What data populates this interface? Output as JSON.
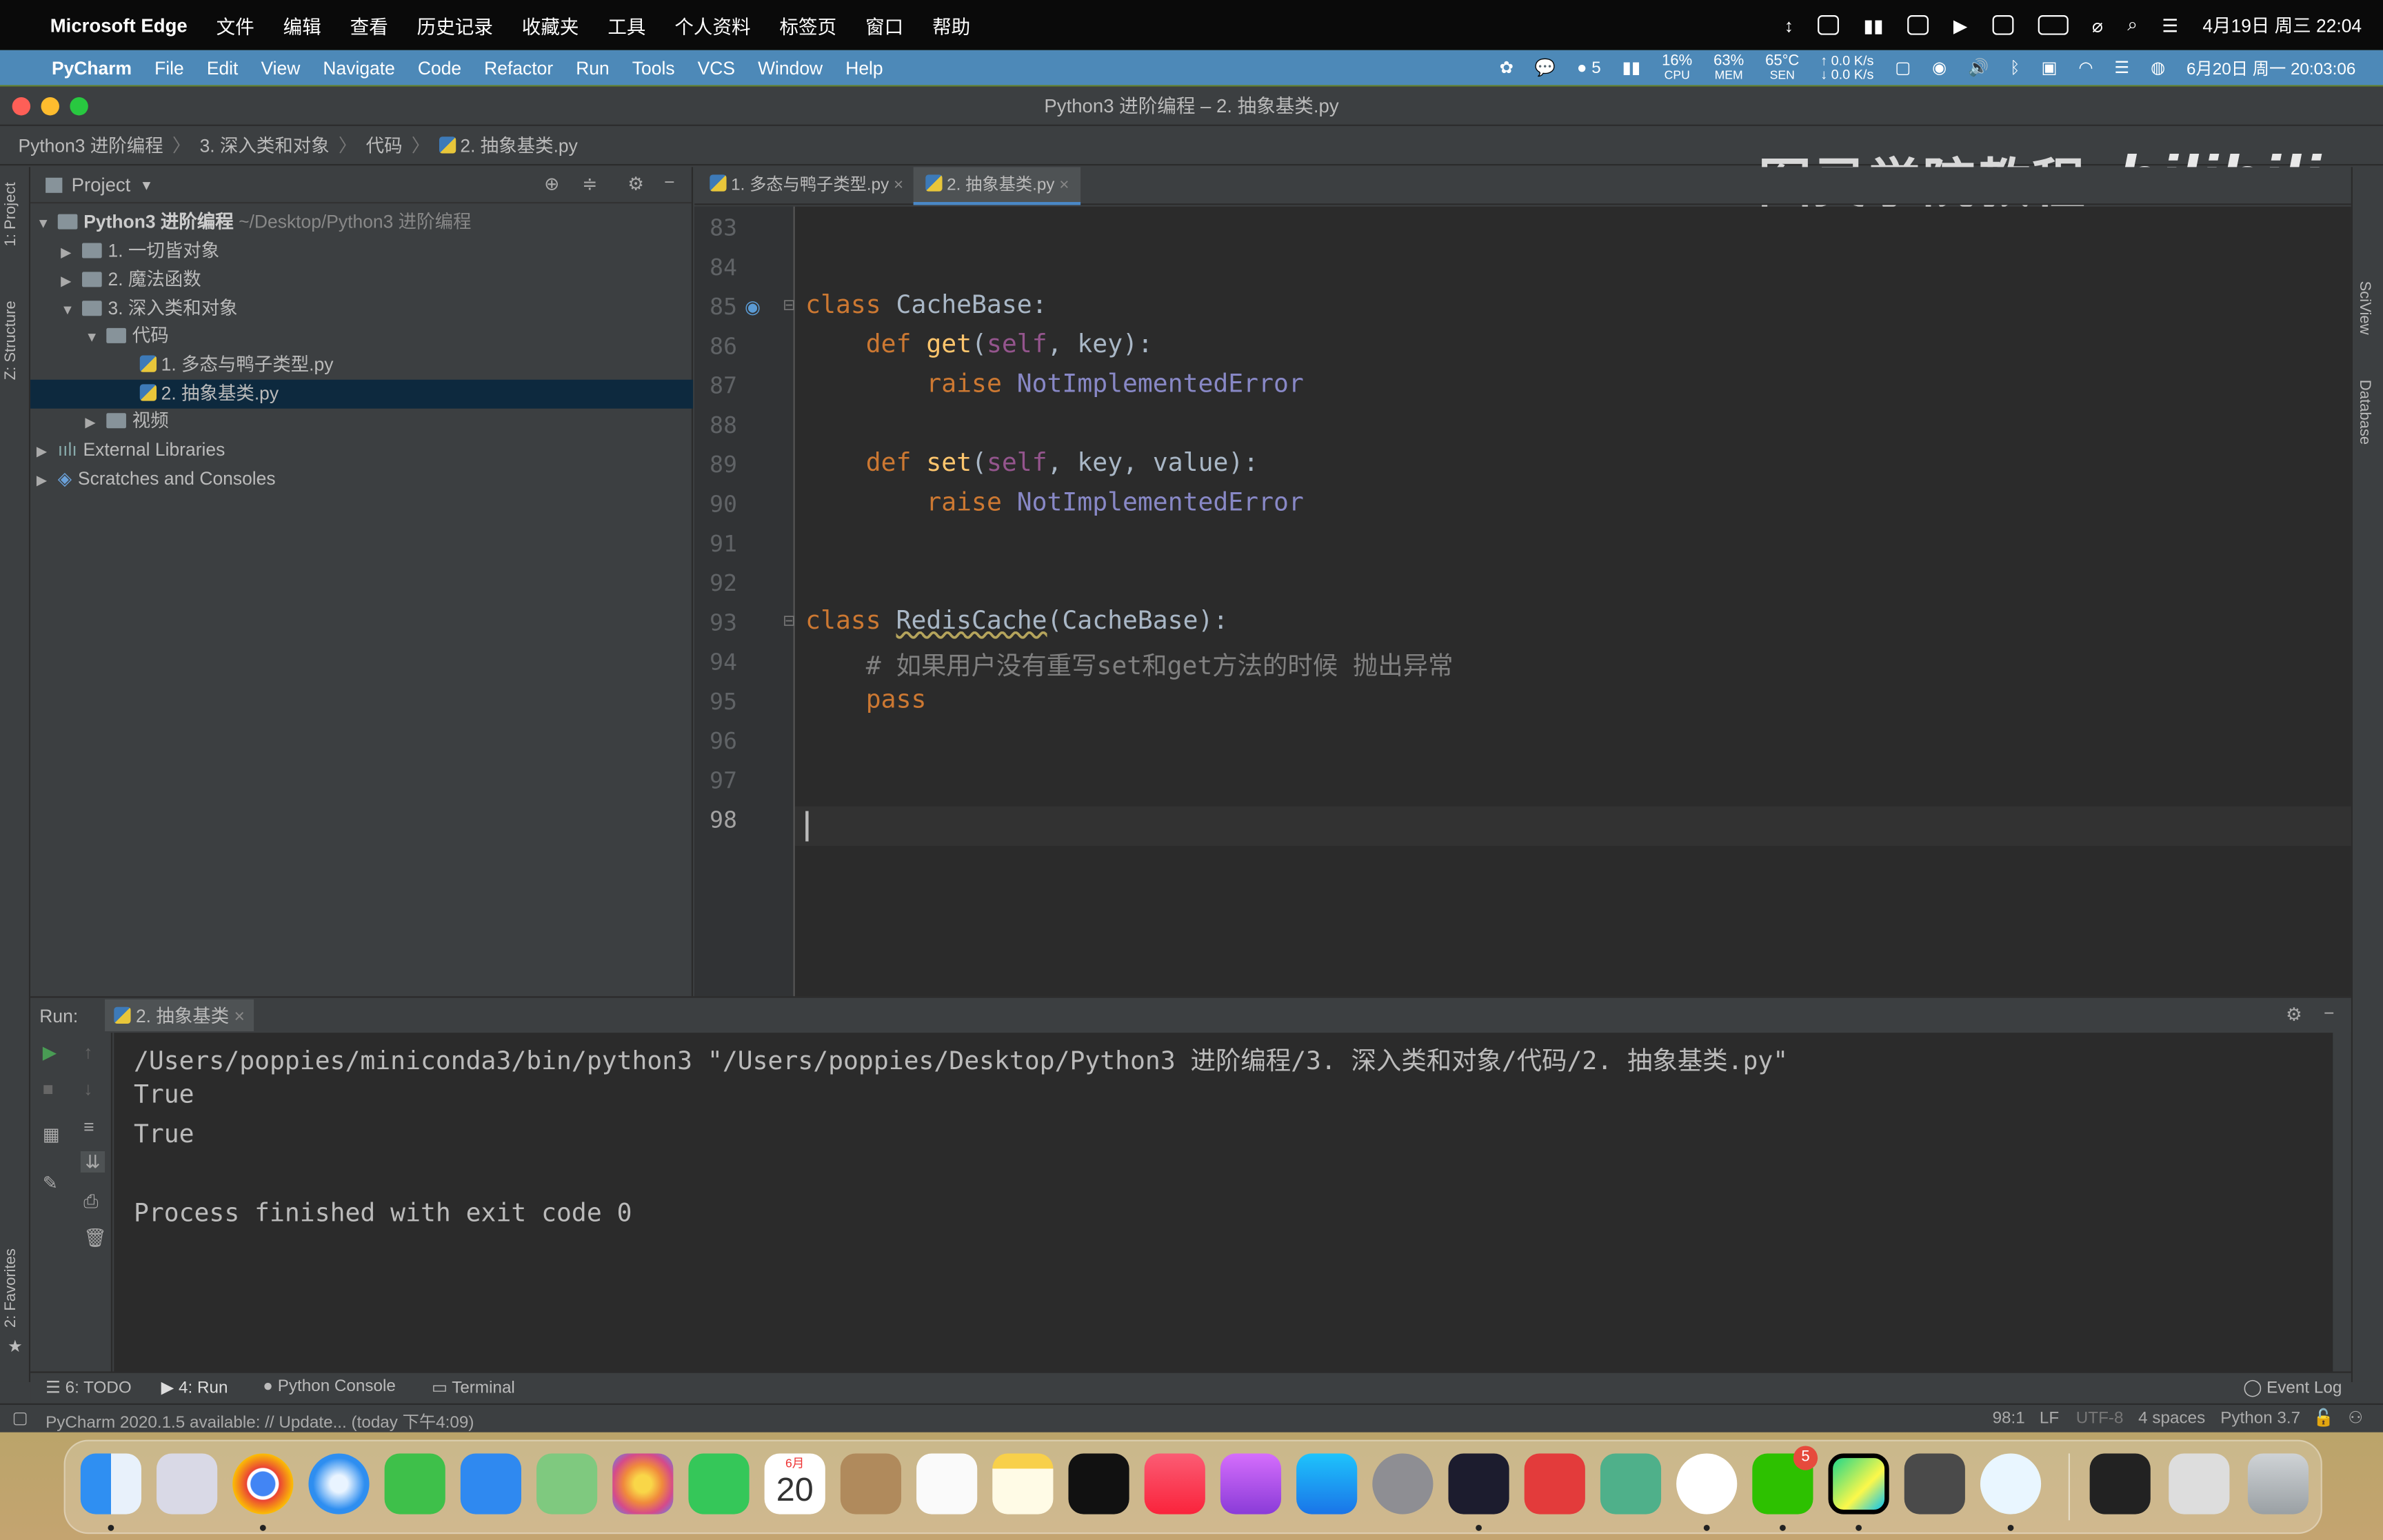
{
  "mac_menu": {
    "app": "Microsoft Edge",
    "items": [
      "文件",
      "编辑",
      "查看",
      "历史记录",
      "收藏夹",
      "工具",
      "个人资料",
      "标签页",
      "窗口",
      "帮助"
    ],
    "datetime": "4月19日 周三 22:04"
  },
  "pc_menu": {
    "app": "PyCharm",
    "items": [
      "File",
      "Edit",
      "View",
      "Navigate",
      "Code",
      "Refactor",
      "Run",
      "Tools",
      "VCS",
      "Window",
      "Help"
    ],
    "wechat_count": "5",
    "cpu": "16%",
    "cpu_label": "CPU",
    "mem": "63%",
    "mem_label": "MEM",
    "temp": "65°C",
    "temp_label": "SEN",
    "net_up": "↑ 0.0 K/s",
    "net_down": "↓ 0.0 K/s",
    "datetime": "6月20日 周一 20:03:06"
  },
  "window": {
    "title": "Python3 进阶编程 – 2. 抽象基类.py"
  },
  "breadcrumb": [
    "Python3 进阶编程",
    "3. 深入类和对象",
    "代码",
    "2. 抽象基类.py"
  ],
  "watermark": {
    "text": "图灵学院教程",
    "logo": "bilibili"
  },
  "left_strip": {
    "project_tab": "1: Project",
    "structure_tab": "Z: Structure",
    "favorites_tab": "2: Favorites"
  },
  "right_strip": {
    "sciview": "SciView",
    "database": "Database"
  },
  "project": {
    "title": "Project",
    "root": {
      "name": "Python3 进阶编程",
      "path": "~/Desktop/Python3 进阶编程"
    },
    "items": [
      {
        "label": "1. 一切皆对象"
      },
      {
        "label": "2. 魔法函数"
      },
      {
        "label": "3. 深入类和对象"
      },
      {
        "label": "代码"
      },
      {
        "label": "1. 多态与鸭子类型.py"
      },
      {
        "label": "2. 抽象基类.py"
      },
      {
        "label": "视频"
      },
      {
        "label": "External Libraries"
      },
      {
        "label": "Scratches and Consoles"
      }
    ]
  },
  "tabs": [
    {
      "label": "1. 多态与鸭子类型.py"
    },
    {
      "label": "2. 抽象基类.py"
    }
  ],
  "editor": {
    "line_numbers": [
      "83",
      "84",
      "85",
      "86",
      "87",
      "88",
      "89",
      "90",
      "91",
      "92",
      "93",
      "94",
      "95",
      "96",
      "97",
      "98"
    ],
    "comment": "# 如果用户没有重写set和get方法的时候 抛出异常"
  },
  "run": {
    "label": "Run:",
    "config": "2. 抽象基类",
    "lines": [
      "/Users/poppies/miniconda3/bin/python3 \"/Users/poppies/Desktop/Python3 进阶编程/3. 深入类和对象/代码/2. 抽象基类.py\"",
      "True",
      "True",
      "",
      "Process finished with exit code 0"
    ]
  },
  "bottom_tabs": {
    "todo": "6: TODO",
    "run": "4: Run",
    "console": "Python Console",
    "terminal": "Terminal",
    "event_log": "Event Log"
  },
  "status": {
    "message": "PyCharm 2020.1.5 available: // Update... (today 下午4:09)",
    "position": "98:1",
    "line_sep": "LF",
    "encoding": "UTF-8",
    "indent": "4 spaces",
    "interpreter": "Python 3.7"
  },
  "dock": {
    "calendar_month": "6月",
    "calendar_day": "20",
    "wechat_badge": "5"
  }
}
